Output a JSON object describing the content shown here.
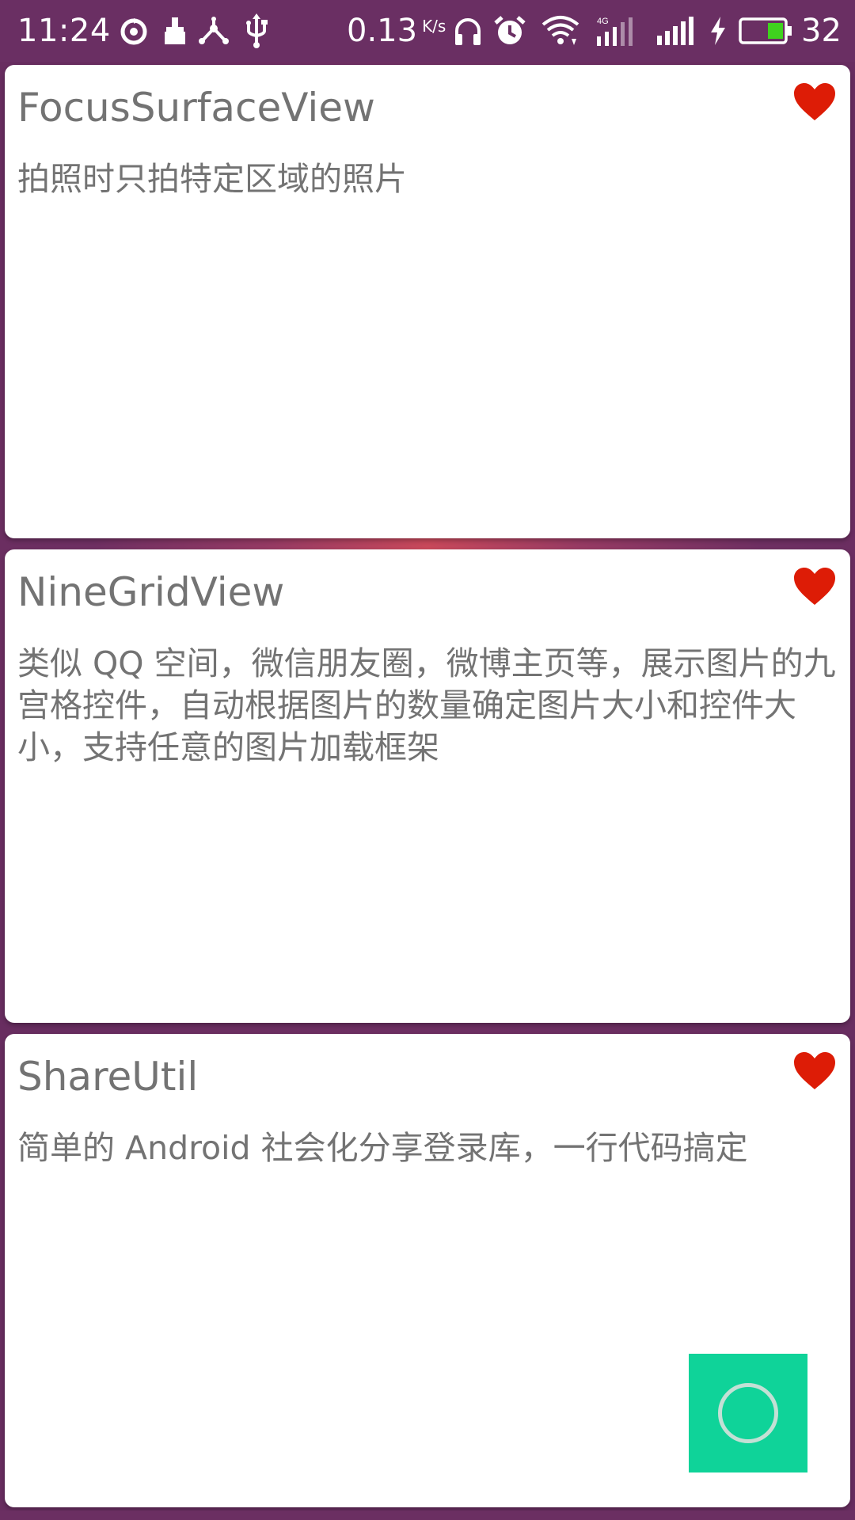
{
  "status_bar": {
    "time": "11:24",
    "net_speed": "0.13",
    "net_speed_unit": "K/s",
    "battery_level": "32",
    "icons": [
      "sync-icon",
      "cleaner-icon",
      "share-network-icon",
      "usb-icon",
      "headphones-icon",
      "alarm-icon",
      "wifi-icon",
      "signal-4g-icon",
      "signal-icon",
      "charging-icon",
      "battery-icon"
    ]
  },
  "cards": [
    {
      "title": "FocusSurfaceView",
      "description": "拍照时只拍特定区域的照片",
      "favorite": true
    },
    {
      "title": "NineGridView",
      "description": "类似 QQ 空间，微信朋友圈，微博主页等，展示图片的九宫格控件，自动根据图片的数量确定图片大小和控件大小，支持任意的图片加载框架",
      "favorite": true
    },
    {
      "title": "ShareUtil",
      "description": "简单的 Android 社会化分享登录库，一行代码搞定",
      "favorite": true
    }
  ],
  "colors": {
    "accent_heart": "#dd1c06",
    "fab": "#0fd399",
    "status_bar": "#6a2f63",
    "text": "#737373"
  },
  "fab": {
    "icon": "loading-ring-icon"
  }
}
